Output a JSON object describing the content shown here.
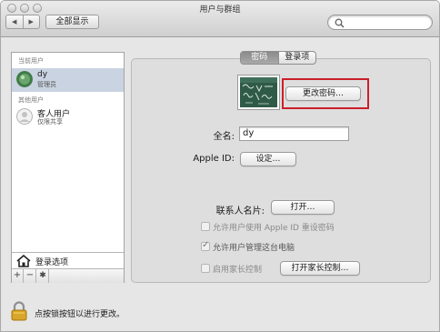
{
  "window": {
    "title": "用户与群组"
  },
  "toolbar": {
    "show_all_label": "全部显示",
    "back_icon": "chevron-left-icon",
    "forward_icon": "chevron-right-icon"
  },
  "search": {
    "placeholder": ""
  },
  "sidebar": {
    "current_users_label": "当前用户",
    "current_user": {
      "name": "dy",
      "role": "管理员"
    },
    "other_users_label": "其他用户",
    "guest_user": {
      "name": "客人用户",
      "role": "仅限共享"
    },
    "login_options_label": "登录选项",
    "add_label": "+",
    "remove_label": "−",
    "gear_label": "✱"
  },
  "tabs": [
    {
      "label": "密码",
      "active": true
    },
    {
      "label": "登录项",
      "active": false
    }
  ],
  "password": {
    "change_password_label": "更改密码…",
    "full_name_label": "全名:",
    "full_name_value": "dy",
    "apple_id_label": "Apple ID:",
    "apple_id_button": "设定…",
    "contact_card_label": "联系人名片:",
    "open_label": "打开…",
    "allow_reset_label": "允许用户使用 Apple ID 重设密码",
    "allow_reset_checked": false,
    "allow_admin_label": "允许用户管理这台电脑",
    "allow_admin_checked": true,
    "parental_label": "启用家长控制",
    "parental_checked": false,
    "open_parental_label": "打开家长控制…"
  },
  "footer": {
    "lock_text": "点按锁按钮以进行更改。"
  },
  "colors": {
    "highlight": "#cc1f2a",
    "selected_row": "#c9d3e1"
  }
}
